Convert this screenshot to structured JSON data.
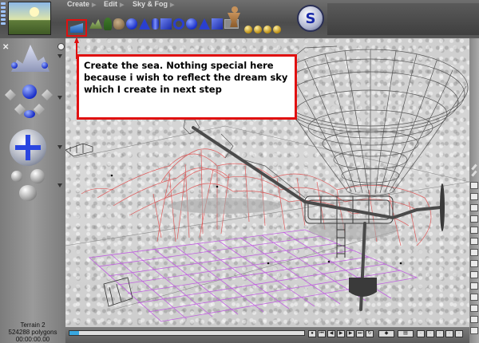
{
  "menu": {
    "create_label": "Create",
    "edit_label": "Edit",
    "sky_fog_label": "Sky & Fog"
  },
  "toolbar": {
    "primitives": [
      "sea",
      "terrain",
      "tree",
      "rock",
      "sphere",
      "cone",
      "cylinder",
      "cube",
      "ring",
      "torus",
      "pyramid",
      "box",
      "blank",
      "blank",
      "gold-sphere",
      "gold-sphere",
      "gold-sphere",
      "gold-sphere"
    ],
    "logo_letter": "S"
  },
  "callout": {
    "text": "Create the sea. Nothing special here because i wish to reflect the dream sky which I create in next step"
  },
  "status": {
    "object_name": "Terrain 2",
    "polygon_count": "524288 polygons",
    "time": "00:00:00.00"
  },
  "colors": {
    "annotation_red": "#e01010",
    "terrain_wire": "#e05050",
    "sea_grid": "#c060e0",
    "balloon_wire": "#555555",
    "primitive_blue": "#2a3fd0"
  },
  "icons": {
    "preview": "scene-preview-icon",
    "logo": "app-logo-icon",
    "move": "move-arrows-icon",
    "figure": "human-figure-icon"
  }
}
